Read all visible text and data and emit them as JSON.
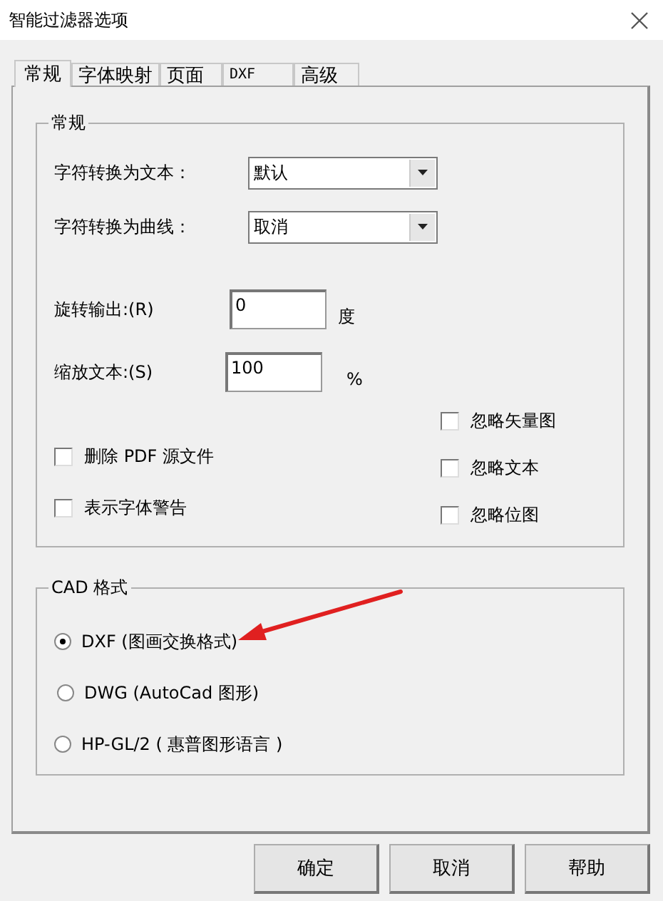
{
  "window": {
    "title": "智能过滤器选项"
  },
  "tabs": [
    {
      "label": "常规",
      "selected": true
    },
    {
      "label": "字体映射",
      "selected": false
    },
    {
      "label": "页面",
      "selected": false
    },
    {
      "label": "DXF",
      "selected": false
    },
    {
      "label": "高级",
      "selected": false
    }
  ],
  "general_group": {
    "title": "常规",
    "dropdowns": [
      {
        "label": "字符转换为文本：",
        "value": "默认"
      },
      {
        "label": "字符转换为曲线：",
        "value": "取消"
      }
    ],
    "fields": [
      {
        "label": "旋转输出:(R)",
        "value": "0",
        "unit": "度"
      },
      {
        "label": "缩放文本:(S)",
        "value": "100",
        "unit": "%"
      }
    ],
    "checkboxes_right": [
      {
        "label": "忽略矢量图",
        "checked": false
      },
      {
        "label": "忽略文本",
        "checked": false
      },
      {
        "label": "忽略位图",
        "checked": false
      }
    ],
    "checkboxes_left": [
      {
        "label": "删除 PDF 源文件",
        "checked": false
      },
      {
        "label": "表示字体警告",
        "checked": false
      }
    ]
  },
  "cad_group": {
    "title": "CAD 格式",
    "options": [
      {
        "label": "DXF (图画交换格式)",
        "selected": true
      },
      {
        "label": "DWG (AutoCad 图形)",
        "selected": false
      },
      {
        "label": "HP-GL/2 ( 惠普图形语言 )",
        "selected": false
      }
    ]
  },
  "buttons": [
    "确定",
    "取消",
    "帮助"
  ]
}
